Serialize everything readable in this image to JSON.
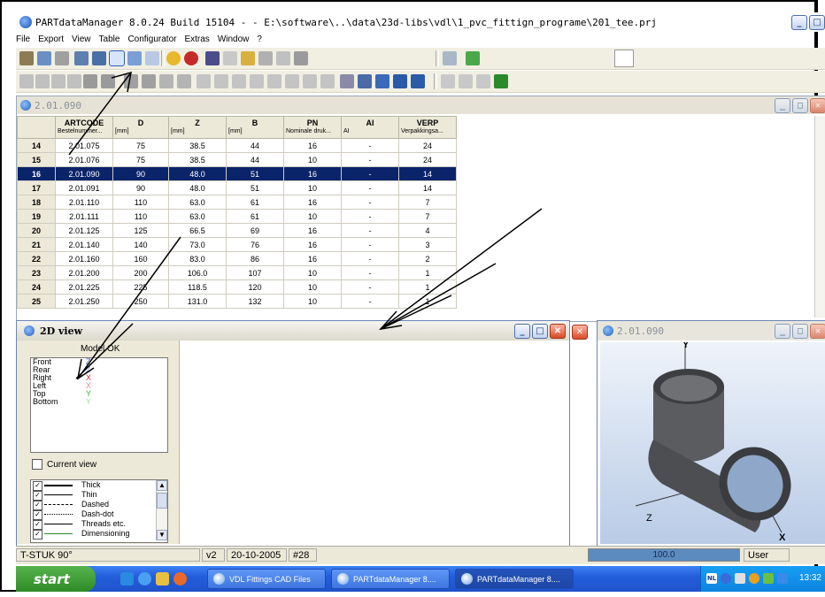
{
  "window": {
    "title": "PARTdataManager 8.0.24 Build 15104 -  - E:\\software\\..\\data\\23d-libs\\vdl\\1_pvc_fittign_programe\\201_tee.prj"
  },
  "menu": [
    "File",
    "Export",
    "View",
    "Table",
    "Configurator",
    "Extras",
    "Window",
    "?"
  ],
  "table_window": {
    "title": "2.01.090",
    "columns": [
      {
        "name": "",
        "sub": ""
      },
      {
        "name": "ARTCODE",
        "sub": "Bestelnummer..."
      },
      {
        "name": "D",
        "sub": "[mm]"
      },
      {
        "name": "Z",
        "sub": "[mm]"
      },
      {
        "name": "B",
        "sub": "[mm]"
      },
      {
        "name": "PN",
        "sub": "Nominale druk..."
      },
      {
        "name": "AI",
        "sub": "AI"
      },
      {
        "name": "VERP",
        "sub": "Verpakkingsa..."
      }
    ],
    "rows": [
      [
        "14",
        "2.01.075",
        "75",
        "38.5",
        "44",
        "16",
        "-",
        "24"
      ],
      [
        "15",
        "2.01.076",
        "75",
        "38.5",
        "44",
        "10",
        "-",
        "24"
      ],
      [
        "16",
        "2.01.090",
        "90",
        "48.0",
        "51",
        "16",
        "-",
        "14"
      ],
      [
        "17",
        "2.01.091",
        "90",
        "48.0",
        "51",
        "10",
        "-",
        "14"
      ],
      [
        "18",
        "2.01.110",
        "110",
        "63.0",
        "61",
        "16",
        "-",
        "7"
      ],
      [
        "19",
        "2.01.111",
        "110",
        "63.0",
        "61",
        "10",
        "-",
        "7"
      ],
      [
        "20",
        "2.01.125",
        "125",
        "66.5",
        "69",
        "16",
        "-",
        "4"
      ],
      [
        "21",
        "2.01.140",
        "140",
        "73.0",
        "76",
        "16",
        "-",
        "3"
      ],
      [
        "22",
        "2.01.160",
        "160",
        "83.0",
        "86",
        "16",
        "-",
        "2"
      ],
      [
        "23",
        "2.01.200",
        "200",
        "106.0",
        "107",
        "10",
        "-",
        "1"
      ],
      [
        "24",
        "2.01.225",
        "225",
        "118.5",
        "120",
        "10",
        "-",
        "1"
      ],
      [
        "25",
        "2.01.250",
        "250",
        "131.0",
        "132",
        "10",
        "-",
        "1"
      ]
    ],
    "selected_row": 2
  },
  "view2d": {
    "title": "2D view",
    "model_label": "Model OK",
    "views": [
      {
        "label": "Front",
        "mark": "Z",
        "color": "#3a4fd0"
      },
      {
        "label": "Rear",
        "mark": "Z",
        "color": "#8a9ae8"
      },
      {
        "label": "Right",
        "mark": "X",
        "color": "#d23030"
      },
      {
        "label": "Left",
        "mark": "X",
        "color": "#e88a8a"
      },
      {
        "label": "Top",
        "mark": "Y",
        "color": "#2fbf2f"
      },
      {
        "label": "Bottom",
        "mark": "Y",
        "color": "#9ee39e"
      }
    ],
    "current_view_label": "Current view",
    "line_styles": [
      {
        "label": "Thick",
        "style": "thick"
      },
      {
        "label": "Thin",
        "style": "thin"
      },
      {
        "label": "Dashed",
        "style": "dashed"
      },
      {
        "label": "Dash-dot",
        "style": "dashdot"
      },
      {
        "label": "Threads etc.",
        "style": "threads"
      },
      {
        "label": "Dimensioning",
        "style": "dim"
      }
    ]
  },
  "view3d": {
    "title": "2.01.090",
    "axes": {
      "x": "X",
      "y": "Y",
      "z": "Z"
    }
  },
  "status": {
    "part": "T-STUK 90°",
    "version": "v2",
    "date": "20-10-2005",
    "number": "#28",
    "progress_text": "100.0",
    "progress_fraction": 1.0,
    "user": "User"
  },
  "taskbar": {
    "start_label": "start",
    "tasks": [
      {
        "label": "VDL Fittings CAD Files"
      },
      {
        "label": "PARTdataManager 8...."
      },
      {
        "label": "PARTdataManager 8...."
      }
    ],
    "active_task": 2,
    "clock": "13:32"
  },
  "colors": {
    "selection": "#0a246a",
    "xp_blue": "#245edb",
    "start_green": "#3a9a32"
  }
}
